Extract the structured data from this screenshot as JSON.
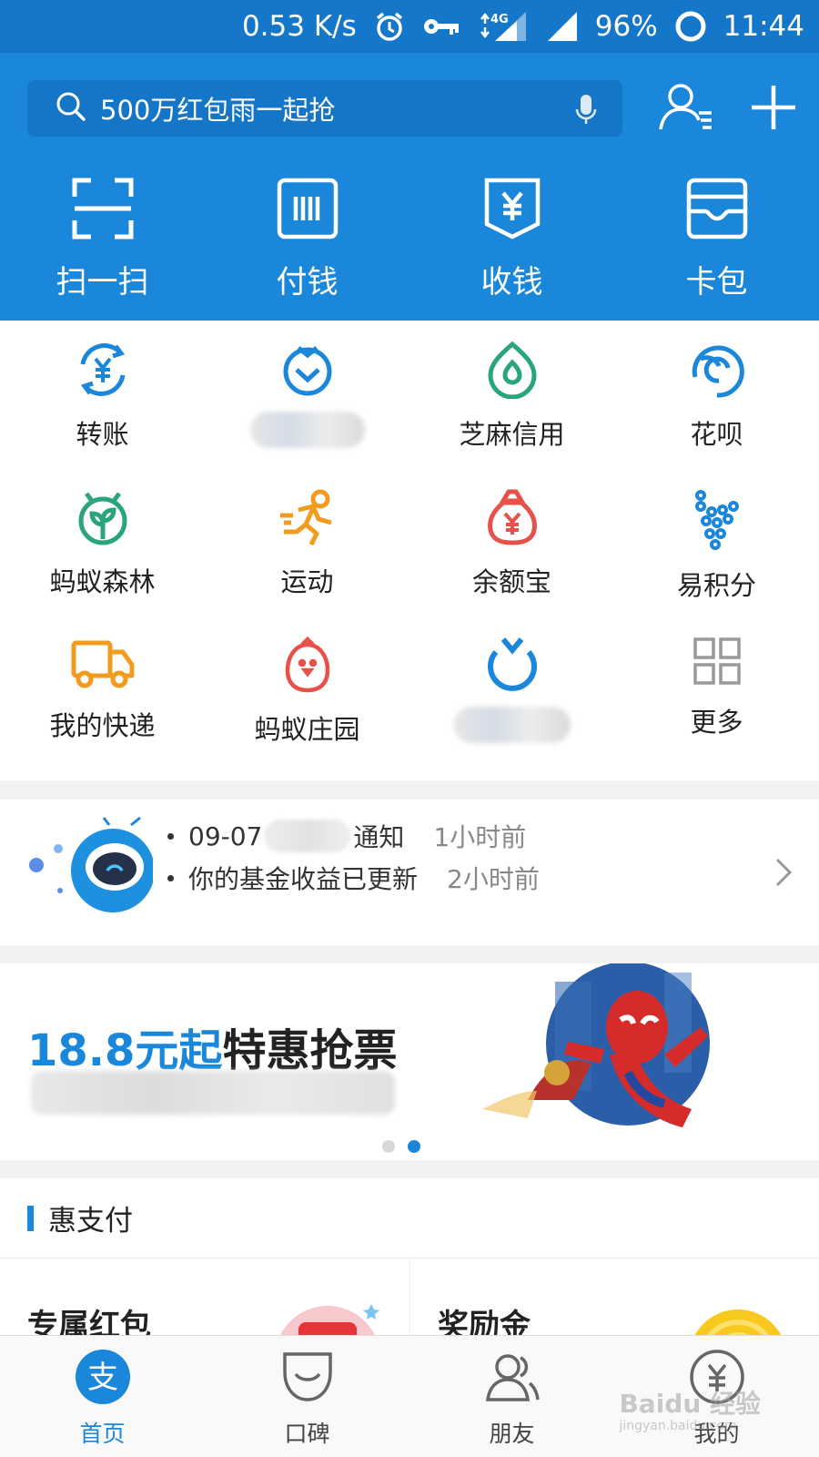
{
  "status_bar": {
    "speed": "0.53 K/s",
    "network": "4G",
    "battery": "96%",
    "time": "11:44"
  },
  "header": {
    "search_placeholder": "500万红包雨一起抢",
    "quick_actions": [
      "扫一扫",
      "付钱",
      "收钱",
      "卡包"
    ]
  },
  "apps": {
    "row1": [
      "转账",
      "",
      "芝麻信用",
      "花呗"
    ],
    "row2": [
      "蚂蚁森林",
      "运动",
      "余额宝",
      "易积分"
    ],
    "row3": [
      "我的快递",
      "蚂蚁庄园",
      "",
      "更多"
    ]
  },
  "notice": {
    "items": [
      {
        "text_prefix": "09-07",
        "text_suffix": "通知",
        "time": "1小时前"
      },
      {
        "text_prefix": "你的基金收益已更新",
        "text_suffix": "",
        "time": "2小时前"
      }
    ]
  },
  "banner": {
    "price": "18.8元起",
    "rest": "特惠抢票",
    "page_count": 2,
    "active_page": 2
  },
  "section": {
    "title": "惠支付",
    "cards": [
      "专属红包",
      "奖励金"
    ]
  },
  "tabbar": {
    "tabs": [
      "首页",
      "口碑",
      "朋友",
      "我的"
    ],
    "active": "首页"
  },
  "watermark": {
    "brand": "Baidu 经验",
    "url": "jingyan.baidu.com"
  },
  "colors": {
    "brand_blue": "#1a87da",
    "status_blue": "#1577c9",
    "green": "#2aa57a",
    "orange": "#f29c1f",
    "red": "#e8514a"
  }
}
